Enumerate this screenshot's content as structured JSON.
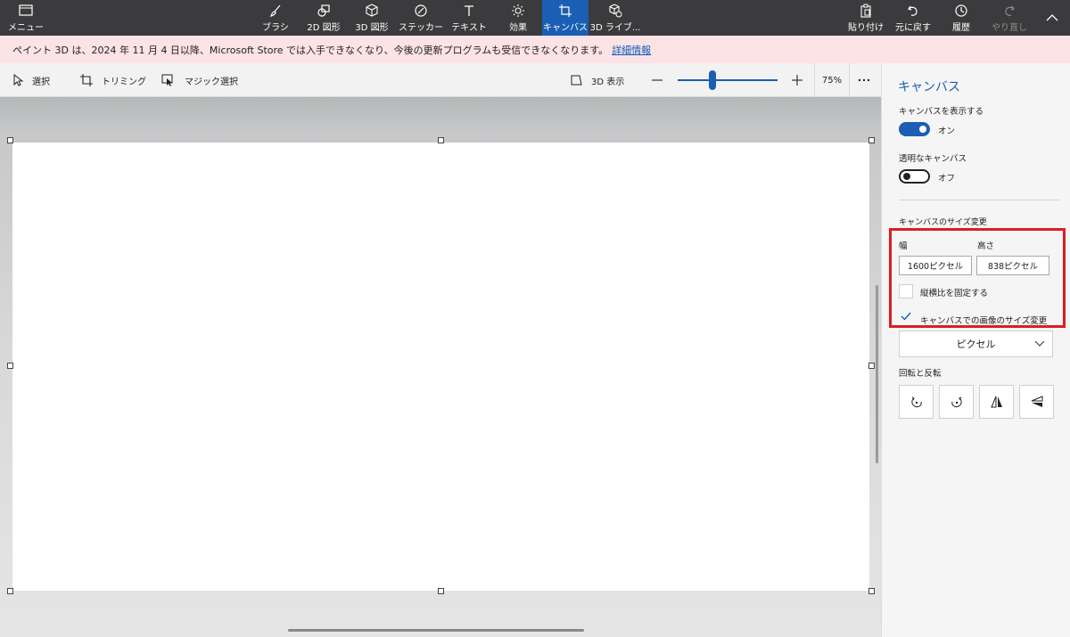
{
  "topbar": {
    "menu_label": "メニュー",
    "tools": [
      {
        "label": "ブラシ"
      },
      {
        "label": "2D 図形"
      },
      {
        "label": "3D 図形"
      },
      {
        "label": "ステッカー"
      },
      {
        "label": "テキスト"
      },
      {
        "label": "効果"
      },
      {
        "label": "キャンバス"
      },
      {
        "label": "3D ライブ..."
      }
    ],
    "actions": [
      {
        "label": "貼り付け"
      },
      {
        "label": "元に戻す"
      },
      {
        "label": "履歴"
      },
      {
        "label": "やり直し"
      }
    ]
  },
  "notice": {
    "text": "ペイント 3D は、2024 年 11 月 4 日以降、Microsoft Store では入手できなくなり、今後の更新プログラムも受信できなくなります。",
    "link": "詳細情報"
  },
  "subbar": {
    "select_label": "選択",
    "crop_label": "トリミング",
    "magic_select_label": "マジック選択",
    "view3d_label": "3D 表示",
    "zoom_percent": "75%",
    "zoom_level": 0.35
  },
  "panel": {
    "title": "キャンバス",
    "show_canvas_label": "キャンバスを表示する",
    "show_canvas_state": "オン",
    "transparent_label": "透明なキャンバス",
    "transparent_state": "オフ",
    "resize_label": "キャンバスのサイズ変更",
    "width_label": "幅",
    "height_label": "高さ",
    "width_value": "1600ピクセル",
    "height_value": "838ピクセル",
    "lock_aspect_label": "縦横比を固定する",
    "resize_image_label": "キャンバスでの画像のサイズ変更",
    "unit_value": "ピクセル",
    "rotate_flip_label": "回転と反転"
  },
  "colors": {
    "accent": "#1a5fb4",
    "topbar": "#3b3b3d",
    "notice_bg": "#fbe3e6",
    "highlight": "#e01b24"
  }
}
